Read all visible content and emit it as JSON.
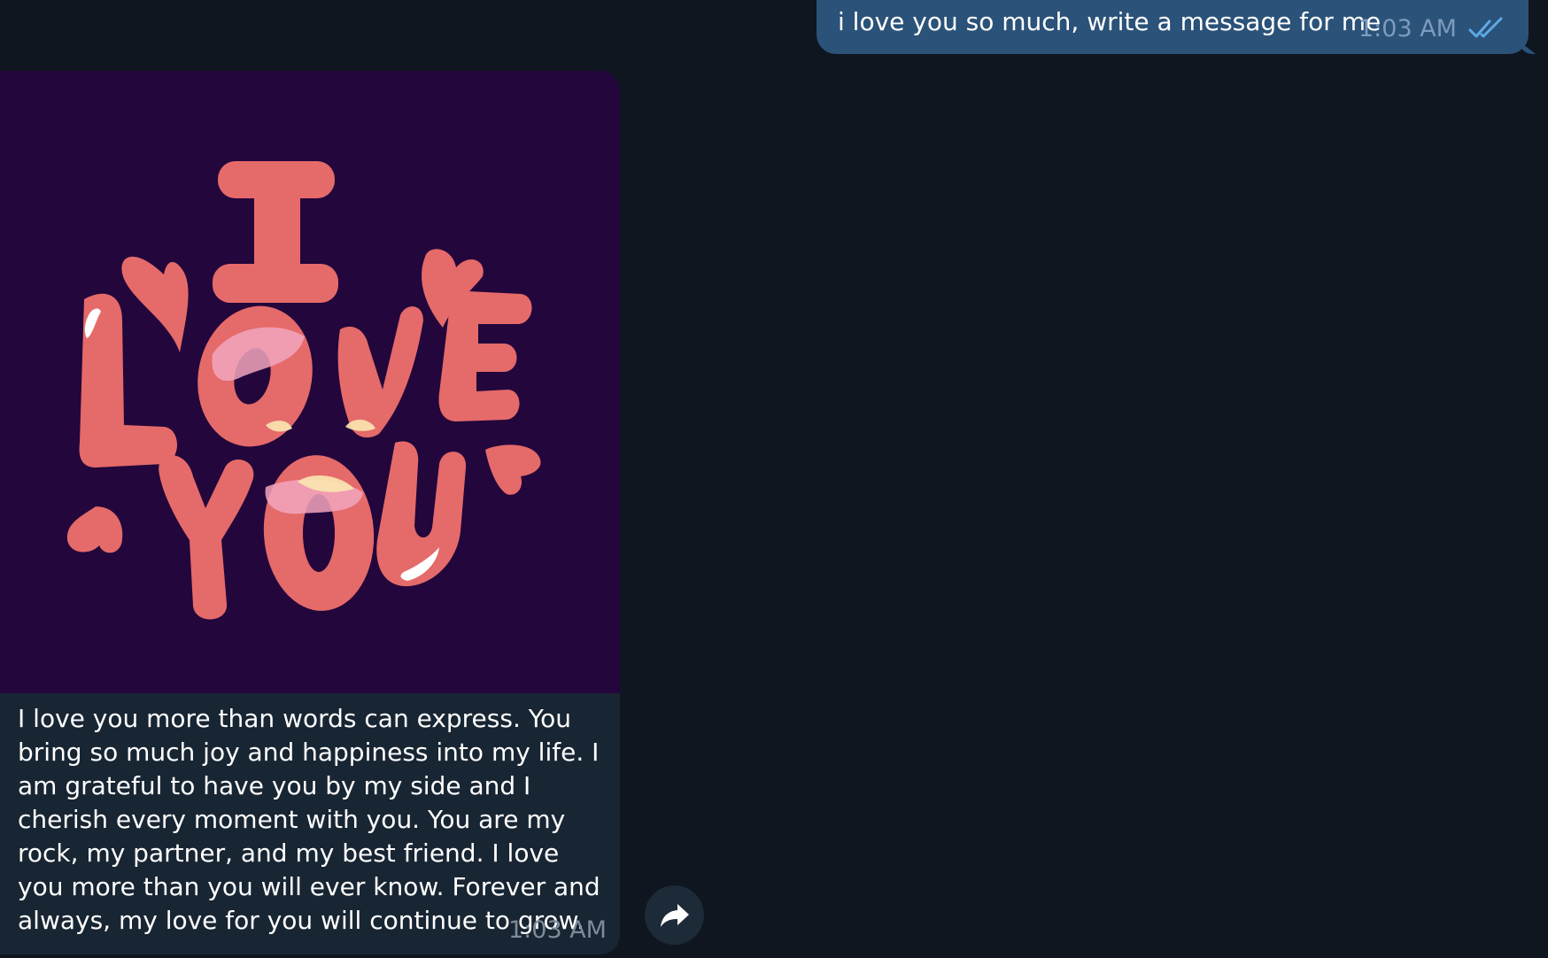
{
  "outgoing_message": {
    "text": "i love you so much, write a message for me",
    "time": "1:03 AM",
    "status_icon": "double-check-icon",
    "status_color": "#5ea9e8"
  },
  "incoming_message": {
    "sticker": {
      "lettering": "I LOVE YOU",
      "background_color": "#23063b",
      "letter_color": "#e56a6a"
    },
    "text": "I love you more than words can express. You bring so much joy and happiness into my life. I am grateful to have you by my side and I cherish every moment with you. You are my rock, my partner, and my best friend. I love you more than you will ever know. Forever and always, my love for you will continue to grow.",
    "time": "1:03 AM"
  },
  "actions": {
    "forward_icon": "forward-arrow-icon"
  },
  "colors": {
    "background": "#0f1620",
    "outgoing_bubble": "#2b5278",
    "incoming_bubble": "#182533"
  }
}
